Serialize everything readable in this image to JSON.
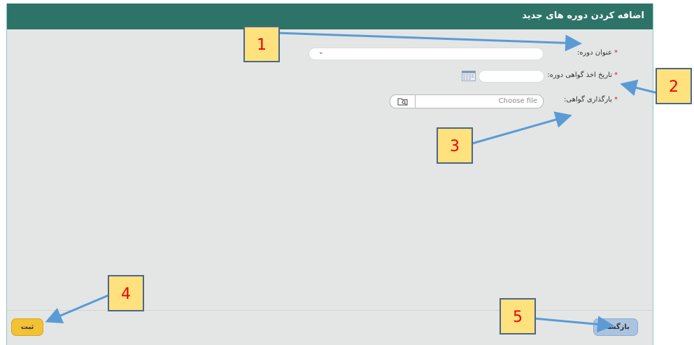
{
  "dialog": {
    "title": "اضافه کردن دوره های جدید",
    "fields": {
      "course_title_label": "عنوان دوره:",
      "certificate_date_label": "تاریخ اخذ گواهی دوره:",
      "certificate_upload_label": "بارگذاری گواهی:",
      "required_mark": "*",
      "file_placeholder": "Choose file"
    },
    "buttons": {
      "submit": "ثبت",
      "back": "بازگشت"
    }
  },
  "callouts": [
    "1",
    "2",
    "3",
    "4",
    "5"
  ],
  "colors": {
    "header": "#2e7368",
    "panel": "#e3e6e5",
    "submit": "#f3c134",
    "back": "#aac3e0",
    "callout": "#ffe17d",
    "arrow": "#5b9bd5"
  }
}
